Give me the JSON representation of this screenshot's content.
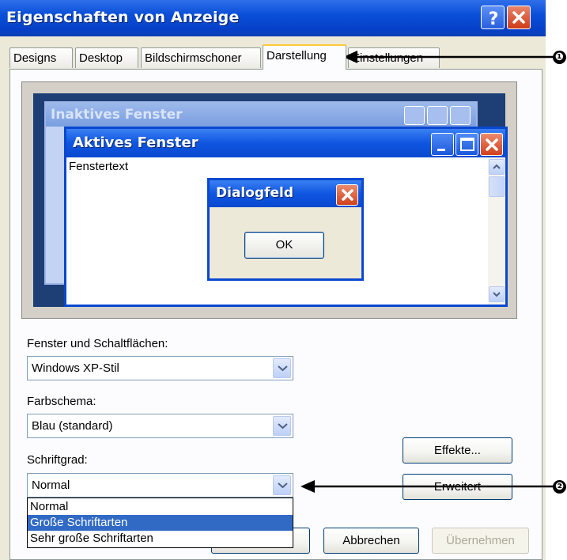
{
  "window": {
    "title": "Eigenschaften von Anzeige",
    "help_icon": "question-mark-icon",
    "close_icon": "close-x-icon"
  },
  "tabs": [
    {
      "label": "Designs",
      "active": false
    },
    {
      "label": "Desktop",
      "active": false
    },
    {
      "label": "Bildschirmschoner",
      "active": false
    },
    {
      "label": "Darstellung",
      "active": true
    },
    {
      "label": "Einstellungen",
      "active": false
    }
  ],
  "preview": {
    "inactive_title": "Inaktives Fenster",
    "active_title": "Aktives Fenster",
    "window_text": "Fenstertext",
    "message_title": "Dialogfeld",
    "ok_label": "OK"
  },
  "form": {
    "windows_label": "Fenster und Schaltflächen:",
    "windows_value": "Windows XP-Stil",
    "color_label": "Farbschema:",
    "color_value": "Blau (standard)",
    "font_label": "Schriftgrad:",
    "font_value": "Normal",
    "font_options": [
      "Normal",
      "Große Schriftarten",
      "Sehr große Schriftarten"
    ],
    "font_selected_index": 1
  },
  "buttons": {
    "effects": "Effekte...",
    "advanced": "Erweitert",
    "cancel": "Abbrechen",
    "apply": "Übernehmen"
  },
  "annotations": {
    "marker1": "❶",
    "marker2": "❷"
  },
  "colors": {
    "title_blue": "#0A4FD8",
    "dialog_bg": "#ECE9D8",
    "selection": "#316AC5",
    "tab_highlight": "#FFC83C"
  }
}
